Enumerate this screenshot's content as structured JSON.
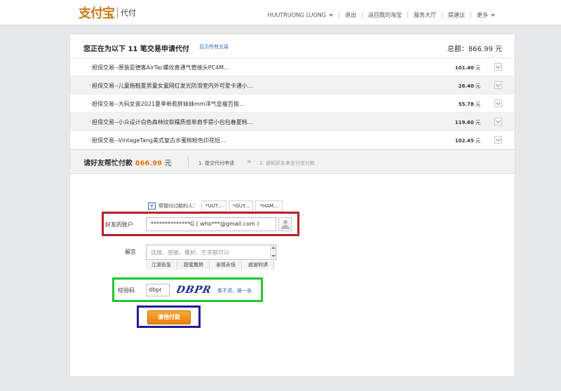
{
  "header": {
    "logo": "支付宝",
    "section": "代付",
    "user": "HUUTRUONG LUONG",
    "nav": [
      "退出",
      "返回我的淘宝",
      "服务大厅",
      "提建议",
      "更多"
    ]
  },
  "summary": {
    "title": "您正在为以下 11 笔交易申请代付",
    "show_all": "显示所有交易",
    "total_label": "总额：",
    "total_value": "866.99",
    "currency": "元"
  },
  "orders": [
    {
      "name": "担保交易--原装亚德客AirTac螺纹直通气管接头PC4M...",
      "price": "101.40"
    },
    {
      "name": "担保交易--儿童拖鞋夏男童女童网红发光防滑室内外可爱卡通小...",
      "price": "26.40"
    },
    {
      "name": "担保交易--大码女装2021夏季新款胖妹妹mm洋气显瘦百搭...",
      "price": "55.78"
    },
    {
      "name": "担保交易--小众设计白色森林纹软糯质感单肩手提小包包春夏韩...",
      "price": "119.60"
    },
    {
      "name": "担保交易--VintageTang美式复古水蜜桃粉色印花短...",
      "price": "102.45"
    }
  ],
  "payment": {
    "ask_label": "请好友帮忙付款",
    "amount": "866.99",
    "currency": "元",
    "step1": "1. 提交代付申请",
    "arrow": ">",
    "step2": "2. 通知好友来支付宝付款"
  },
  "form": {
    "helper_icon": "¥",
    "helper_label": "帮我付过款的人：",
    "helper_chips": [
      "*UUT...",
      "*GUY...",
      "*HAM..."
    ],
    "account_label": "好友的账户",
    "account_value": "**************G ( who***@gmail.com )",
    "message_label": "留言",
    "message_placeholder": "选填，感谢、撒娇、乞求都可以",
    "quick_phrases": [
      "江湖告急",
      "甜蜜撒娇",
      "亲情永恒",
      "戚谢利诱"
    ],
    "code_label": "校验码",
    "code_value": "dbpr",
    "captcha_text": "DBPR",
    "refresh_label": "看不清，换一张",
    "submit_label": "请他付款"
  },
  "annotations": {
    "red": "#b8202a",
    "green": "#21c62c",
    "blue": "#1f1d9c"
  }
}
